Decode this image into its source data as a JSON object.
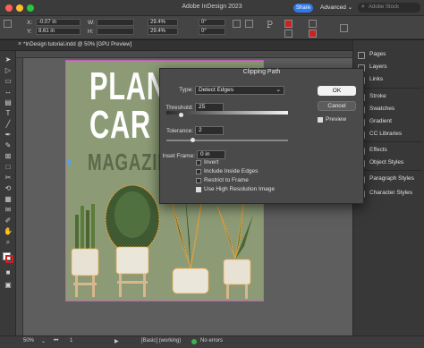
{
  "app": {
    "title": "Adobe InDesign 2023",
    "share_label": "Share",
    "workspace_label": "Advanced",
    "search_placeholder": "Adobe Stock"
  },
  "control_bar": {
    "x_label": "X:",
    "x_value": "-0.07 in",
    "y_label": "Y:",
    "y_value": "8.61 in",
    "w_label": "W:",
    "h_label": "H:",
    "scale_x": "29.4%",
    "scale_y": "29.4%",
    "angle": "0°",
    "shear": "0°"
  },
  "document": {
    "tab_label": "*InDesign tutorial.indd @ 50% [GPU Preview]",
    "headline_1": "PLAN",
    "headline_2": "CAR",
    "headline_3": "MAGAZIN"
  },
  "dialog": {
    "title": "Clipping Path",
    "type_label": "Type:",
    "type_value": "Detect Edges",
    "threshold_label": "Threshold:",
    "threshold_value": "25",
    "threshold_level": 0.1,
    "tolerance_label": "Tolerance:",
    "tolerance_value": "2",
    "tolerance_level": 0.2,
    "inset_label": "Inset Frame:",
    "inset_value": "0 in",
    "options": [
      {
        "label": "Invert",
        "checked": false
      },
      {
        "label": "Include Inside Edges",
        "checked": false
      },
      {
        "label": "Restrict to Frame",
        "checked": false
      },
      {
        "label": "Use High Resolution Image",
        "checked": true
      }
    ],
    "ok_label": "OK",
    "cancel_label": "Cancel",
    "preview_label": "Preview",
    "preview_checked": true
  },
  "right_panel": {
    "items": [
      {
        "label": "Pages",
        "icon": "pages-icon"
      },
      {
        "label": "Layers",
        "icon": "layers-icon"
      },
      {
        "label": "Links",
        "icon": "links-icon"
      },
      {
        "label": "Stroke",
        "icon": "stroke-icon"
      },
      {
        "label": "Swatches",
        "icon": "swatches-icon"
      },
      {
        "label": "Gradient",
        "icon": "gradient-icon"
      },
      {
        "label": "CC Libraries",
        "icon": "cc-libraries-icon"
      },
      {
        "label": "Effects",
        "icon": "effects-icon"
      },
      {
        "label": "Object Styles",
        "icon": "object-styles-icon"
      },
      {
        "label": "Paragraph Styles",
        "icon": "paragraph-styles-icon"
      },
      {
        "label": "Character Styles",
        "icon": "character-styles-icon"
      }
    ]
  },
  "status_bar": {
    "zoom": "50%",
    "page": "1",
    "style": "[Basic] (working)",
    "errors": "No errors"
  },
  "colors": {
    "accent_blue": "#2f79e8",
    "frame_magenta": "#c95bc5",
    "clip_path_orange": "#f1a23a",
    "page_green": "#8c9b76"
  }
}
